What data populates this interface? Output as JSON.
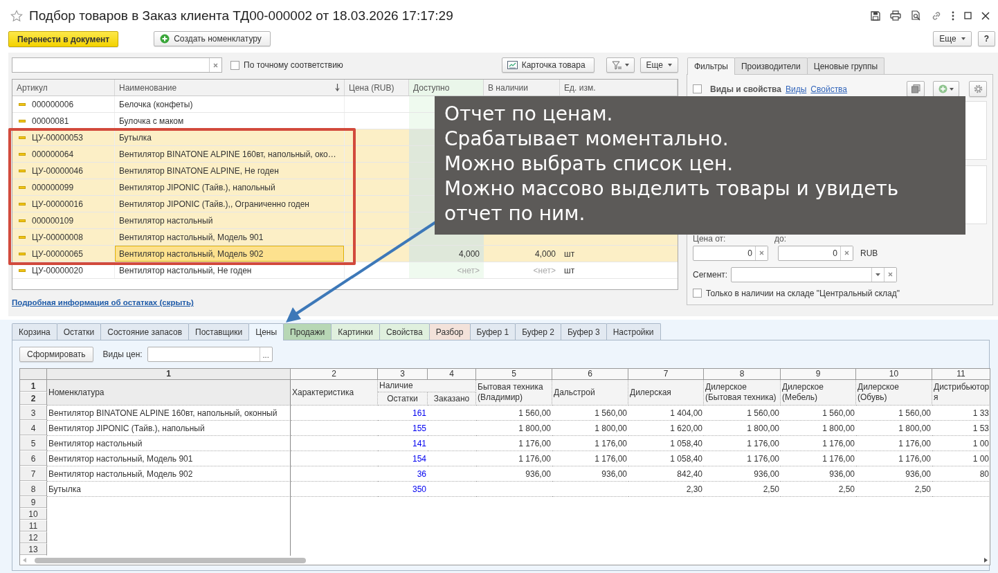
{
  "window": {
    "title": "Подбор товаров в Заказ клиента ТД00-000002 от 18.03.2026 17:17:29",
    "favorite": false
  },
  "toolbar": {
    "transfer_button": "Перенести в документ",
    "create_button": "Создать номенклатуру",
    "more_button": "Еще",
    "help_button": "?"
  },
  "search": {
    "exact_match_label": "По точному соответствию",
    "exact_match_checked": false
  },
  "list_toolbar": {
    "card_button": "Карточка товара",
    "more_button": "Еще"
  },
  "products": {
    "columns": [
      "Артикул",
      "Наименование",
      "Цена (RUB)",
      "Доступно",
      "В наличии",
      "Ед. изм."
    ],
    "rows": [
      {
        "article": "000000006",
        "name": "Белочка (конфеты)",
        "selected": false,
        "focused": false
      },
      {
        "article": "00000081",
        "name": "Булочка с маком",
        "selected": false,
        "focused": false
      },
      {
        "article": "ЦУ-00000053",
        "name": "Бутылка",
        "selected": true,
        "focused": false
      },
      {
        "article": "000000064",
        "name": "Вентилятор BINATONE ALPINE 160вт, напольный, око…",
        "selected": true,
        "focused": false
      },
      {
        "article": "ЦУ-00000046",
        "name": "Вентилятор BINATONE ALPINE, Не годен",
        "selected": true,
        "focused": false
      },
      {
        "article": "000000099",
        "name": "Вентилятор JIPONIC (Тайв.), напольный",
        "selected": true,
        "focused": false
      },
      {
        "article": "ЦУ-00000016",
        "name": "Вентилятор JIPONIC (Тайв.),, Ограниченно годен",
        "selected": true,
        "focused": false
      },
      {
        "article": "000000109",
        "name": "Вентилятор настольный",
        "selected": true,
        "focused": false
      },
      {
        "article": "ЦУ-00000008",
        "name": "Вентилятор настольный, Модель 901",
        "selected": true,
        "focused": false
      },
      {
        "article": "ЦУ-00000065",
        "name": "Вентилятор настольный, Модель 902",
        "available": "4,000",
        "in_stock": "4,000",
        "unit": "шт",
        "selected": true,
        "focused": true
      },
      {
        "article": "ЦУ-00000020",
        "name": "Вентилятор настольный, Не годен",
        "available": "<нет>",
        "in_stock": "<нет>",
        "unit": "шт",
        "selected": false,
        "focused": false
      }
    ]
  },
  "details_link": "Подробная информация об остатках (скрыть)",
  "filters": {
    "tabs": [
      {
        "label": "Фильтры",
        "selected": true
      },
      {
        "label": "Производители",
        "selected": false
      },
      {
        "label": "Ценовые группы",
        "selected": false
      }
    ],
    "properties_label": "Виды и свойства",
    "properties_checked": false,
    "links": [
      "Виды",
      "Свойства"
    ],
    "price_from_label": "Цена от:",
    "price_from": "0",
    "price_to_label": "до:",
    "price_to": "0",
    "currency": "RUB",
    "segment_label": "Сегмент:",
    "in_stock_label": "Только в наличии на складе \"Центральный склад\"",
    "in_stock_checked": false
  },
  "report_tabs": [
    {
      "label": "Корзина",
      "selected": false,
      "color": "#e2e9f1"
    },
    {
      "label": "Остатки",
      "selected": false,
      "color": "#e2e9f1"
    },
    {
      "label": "Состояние запасов",
      "selected": false,
      "color": "#e2e9f1"
    },
    {
      "label": "Поставщики",
      "selected": false,
      "color": "#e2e9f1"
    },
    {
      "label": "Цены",
      "selected": true,
      "color": "#eef6fd"
    },
    {
      "label": "Продажи",
      "selected": false,
      "color": "#b7d7b5"
    },
    {
      "label": "Картинки",
      "selected": false,
      "color": "#e0f0de"
    },
    {
      "label": "Свойства",
      "selected": false,
      "color": "#e0f0de"
    },
    {
      "label": "Разбор",
      "selected": false,
      "color": "#f3e2da"
    },
    {
      "label": "Буфер 1",
      "selected": false,
      "color": "#e2e9f1"
    },
    {
      "label": "Буфер 2",
      "selected": false,
      "color": "#e2e9f1"
    },
    {
      "label": "Буфер 3",
      "selected": false,
      "color": "#e2e9f1"
    },
    {
      "label": "Настройки",
      "selected": false,
      "color": "#e2e9f1"
    }
  ],
  "report": {
    "build_button": "Сформировать",
    "price_types_label": "Виды цен:",
    "choose_button": "...",
    "column_numbers": [
      "1",
      "2",
      "3",
      "4",
      "5",
      "6",
      "7",
      "8",
      "9",
      "10",
      "11"
    ],
    "header_row_numbers": [
      "1",
      "2"
    ],
    "name_header": "Номенклатура",
    "feature_header": "Характеристика",
    "stock_group_header": "Наличие",
    "stock_headers": [
      "Остатки",
      "Заказано"
    ],
    "price_headers": [
      "Бытовая техника (Владимир)",
      "Дальстрой",
      "Дилерская",
      "Дилерское (Бытовая техника)",
      "Дилерское (Мебель)",
      "Дилерское (Обувь)",
      "Дистрибьютор я"
    ],
    "rows": [
      {
        "number": "3",
        "name": "Вентилятор BINATONE ALPINE 160вт, напольный, оконный",
        "stock": "161",
        "prices": {
          "5": "1 560,00",
          "6": "1 560,00",
          "7": "1 404,00",
          "8": "1 560,00",
          "9": "1 560,00",
          "10": "1 560,00",
          "11": "1 33"
        }
      },
      {
        "number": "4",
        "name": "Вентилятор JIPONIC (Тайв.), напольный",
        "stock": "155",
        "prices": {
          "5": "1 800,00",
          "6": "1 800,00",
          "7": "1 620,00",
          "8": "1 800,00",
          "9": "1 800,00",
          "10": "1 800,00",
          "11": "1 53"
        }
      },
      {
        "number": "5",
        "name": "Вентилятор настольный",
        "stock": "141",
        "prices": {
          "5": "1 176,00",
          "6": "1 176,00",
          "7": "1 058,40",
          "8": "1 176,00",
          "9": "1 176,00",
          "10": "1 176,00",
          "11": "1 00"
        }
      },
      {
        "number": "6",
        "name": "Вентилятор настольный, Модель 901",
        "stock": "154",
        "prices": {
          "5": "1 176,00",
          "6": "1 176,00",
          "7": "1 058,40",
          "8": "1 176,00",
          "9": "1 176,00",
          "10": "1 176,00",
          "11": "1 00"
        }
      },
      {
        "number": "7",
        "name": "Вентилятор настольный, Модель 902",
        "stock": "36",
        "prices": {
          "5": "936,00",
          "6": "936,00",
          "7": "842,40",
          "8": "936,00",
          "9": "936,00",
          "10": "936,00",
          "11": "80"
        }
      },
      {
        "number": "8",
        "name": "Бутылка",
        "stock": "350",
        "prices": {
          "7": "2,30",
          "8": "2,50",
          "9": "2,50",
          "10": "2,50"
        }
      }
    ],
    "empty_row_numbers": [
      "9",
      "10",
      "11",
      "12",
      "13"
    ]
  },
  "callout": {
    "lines": [
      "Отчет по ценам.",
      "Срабатывает моментально.",
      "Можно выбрать список цен.",
      "Можно массово выделить товары и увидеть отчет по ним."
    ]
  }
}
